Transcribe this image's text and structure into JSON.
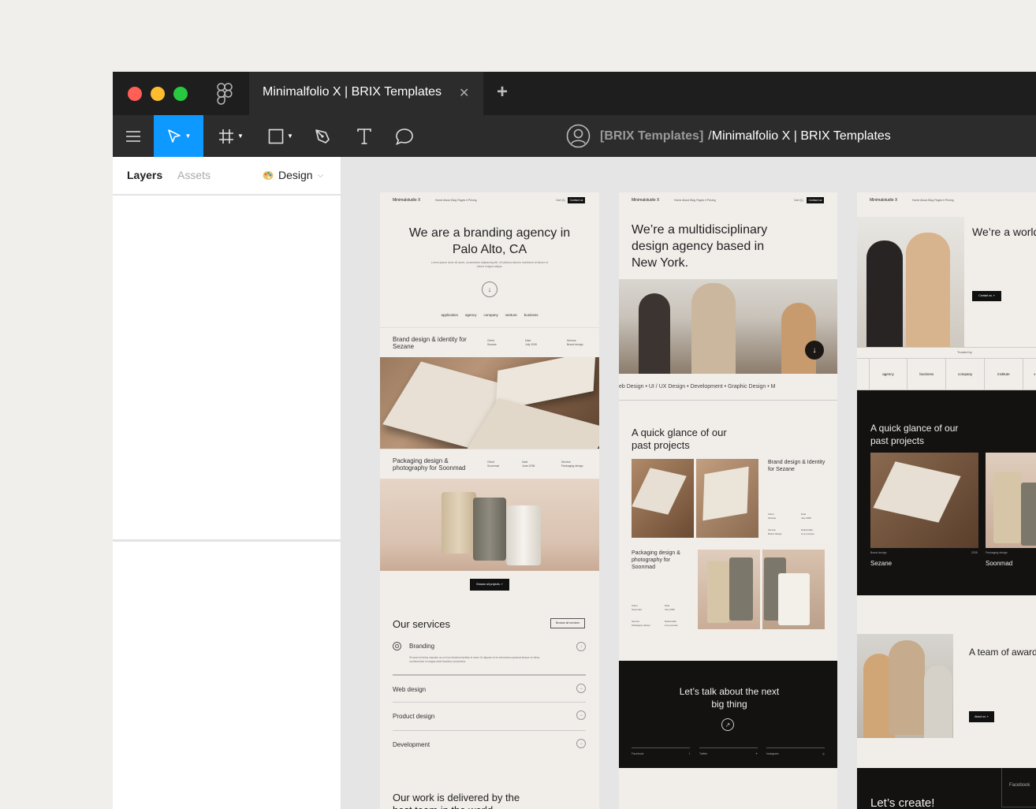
{
  "window": {
    "tab_title": "Minimalfolio X | BRIX Templates",
    "tab_close": "✕",
    "tab_add": "+"
  },
  "breadcrumb": {
    "team": "[BRIX Templates]",
    "separator": "/",
    "file": "Minimalfolio X | BRIX Templates"
  },
  "panel": {
    "tabs": {
      "layers": "Layers",
      "assets": "Assets",
      "design": "Design"
    }
  },
  "frame1": {
    "nav": {
      "logo": "Minimalstudio X",
      "links": "Home   About   Blog   Pages ▾   Pricing",
      "cart": "Cart (1)",
      "cta": "Contact us"
    },
    "hero_title": "We are a branding agency in Palo Alto, CA",
    "hero_sub": "Lorem ipsum dolor sit amet, consectetur adipiscing elit. Ut ultamco laboris incididunt ut labore et dolore magna aliqua.",
    "logos": [
      "application",
      "agency",
      "company",
      "venture",
      "business"
    ],
    "project1": {
      "title": "Brand design & identity for Sezane",
      "client_label": "Client",
      "client": "Sezane",
      "date_label": "Date",
      "date": "July 2035",
      "service_label": "Service",
      "service": "Brand design"
    },
    "project2": {
      "title": "Packaging design & photography for Soonmad",
      "client_label": "Client",
      "client": "Soonmad",
      "date_label": "Date",
      "date": "June 2035",
      "service_label": "Service",
      "service": "Packaging design"
    },
    "browse_projects": "Browse all projects ↗",
    "services_title": "Our services",
    "browse_services": "Browse all services",
    "services": [
      "Branding",
      "Web design",
      "Product design",
      "Development"
    ],
    "branding_desc": "Sit amet sit tellus nascetur ac ut et ac tincidunt facilisis et lorem Ut aliquam et mi elementum placerat tempor mi tellus condimentum et magna amet faucibus consectetur.",
    "delivered": "Our work is delivered by the best team in the world"
  },
  "frame2": {
    "nav": {
      "logo": "Minimalstudio X",
      "links": "Home   About   Blog   Pages ▾   Pricing",
      "cart": "Cart (1)",
      "cta": "Contact us"
    },
    "hero_title": "We’re a multidisciplinary design agency based in New York.",
    "marquee": "eb Design  •  UI / UX Design  •  Development  •  Graphic Design  •  M",
    "glance": "A quick glance of our past projects",
    "project1": {
      "title": "Brand design & Identity for Sezane",
      "client_label": "Client",
      "client": "Sezane",
      "date_label": "Date",
      "date": "July 2035",
      "service_label": "Service",
      "service": "Brand design",
      "deliv_label": "Deliverable",
      "deliv": "Live preview"
    },
    "project2": {
      "title": "Packaging design & photography for Soonmad",
      "client_label": "Client",
      "client": "Soonmad",
      "date_label": "Date",
      "date": "July 2035",
      "service_label": "Service",
      "service": "Packaging design",
      "deliv_label": "Deliverable",
      "deliv": "Live preview"
    },
    "cta_title": "Let’s talk about the next  big thing",
    "footer_links": [
      "Facebook",
      "Twitter",
      "Instagram"
    ]
  },
  "frame3": {
    "nav": {
      "logo": "Minimalstudio X",
      "links": "Home   About   Blog   Pages ▾   Pricing"
    },
    "hero_title": "We’re a world class design agency in Los Angeles",
    "contact_btn": "Contact us ↗",
    "trusted_by": "Trusted by",
    "logos": [
      "agency",
      "business",
      "company",
      "institute",
      "v"
    ],
    "glance": "A quick glance of our past projects",
    "project1_tag": "Brand design",
    "project1_year": "2035",
    "project1_name": "Sezane",
    "project2_tag": "Packaging design",
    "project2_name": "Soonmad",
    "team_title": "A team of award winning designers",
    "about_btn": "About us ↗",
    "lets_create": "Let’s create!",
    "facebook": "Facebook"
  },
  "colors": {
    "titlebar": "#1e1e1e",
    "toolbar": "#2c2c2c",
    "accent": "#0d99ff",
    "canvas": "#e5e5e5",
    "frame_bg": "#f1eeea"
  }
}
